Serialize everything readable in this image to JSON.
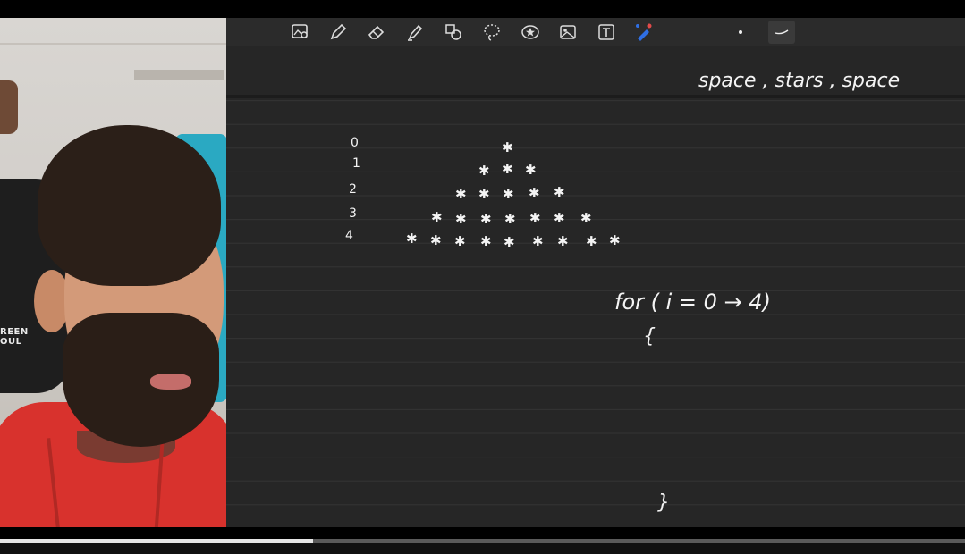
{
  "board": {
    "heading": "space , stars , space",
    "loop_line": "for ( i = 0 → 4)",
    "open_brace": "{",
    "close_brace": "}",
    "row_labels": [
      "0",
      "1",
      "2",
      "3",
      "4"
    ],
    "star_char": "✱"
  },
  "toolbar": {
    "icons": [
      "photo-search-icon",
      "pen-icon",
      "eraser-icon",
      "highlighter-icon",
      "shapes-icon",
      "lasso-icon",
      "sticker-icon",
      "image-icon",
      "text-icon",
      "color-picker-icon",
      "dot-size-icon",
      "stroke-icon"
    ],
    "accent_blue": "#2f6fe4",
    "accent_red": "#e24a4a"
  },
  "webcam": {
    "chair_text": "REEN\nOUL"
  },
  "video": {
    "progress_percent": 32.4
  },
  "colors": {
    "board": "#262626",
    "ink": "#f4f4f4",
    "hoodie": "#d8322d"
  }
}
